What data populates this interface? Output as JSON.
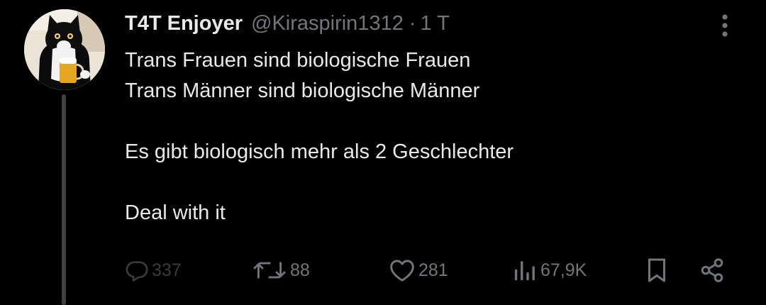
{
  "tweet": {
    "display_name": "T4T Enjoyer",
    "handle": "@Kiraspirin1312",
    "separator": "·",
    "time": "1 T",
    "lines": [
      "Trans Frauen sind biologische Frauen",
      "Trans Männer sind biologische Männer",
      "",
      "Es gibt biologisch mehr als 2 Geschlechter",
      "",
      "Deal with it"
    ]
  },
  "actions": {
    "replies": "337",
    "reposts": "88",
    "likes": "281",
    "views": "67,9K"
  },
  "icons": {
    "more": "more-vertical-icon",
    "reply": "reply-bubble-icon",
    "repost": "repost-arrows-icon",
    "like": "heart-icon",
    "views": "views-bar-chart-icon",
    "bookmark": "bookmark-icon",
    "share": "share-icon"
  },
  "colors": {
    "background": "#000000",
    "text": "#e7e9ea",
    "secondary": "#71767b",
    "thread_line": "#3e4144"
  }
}
